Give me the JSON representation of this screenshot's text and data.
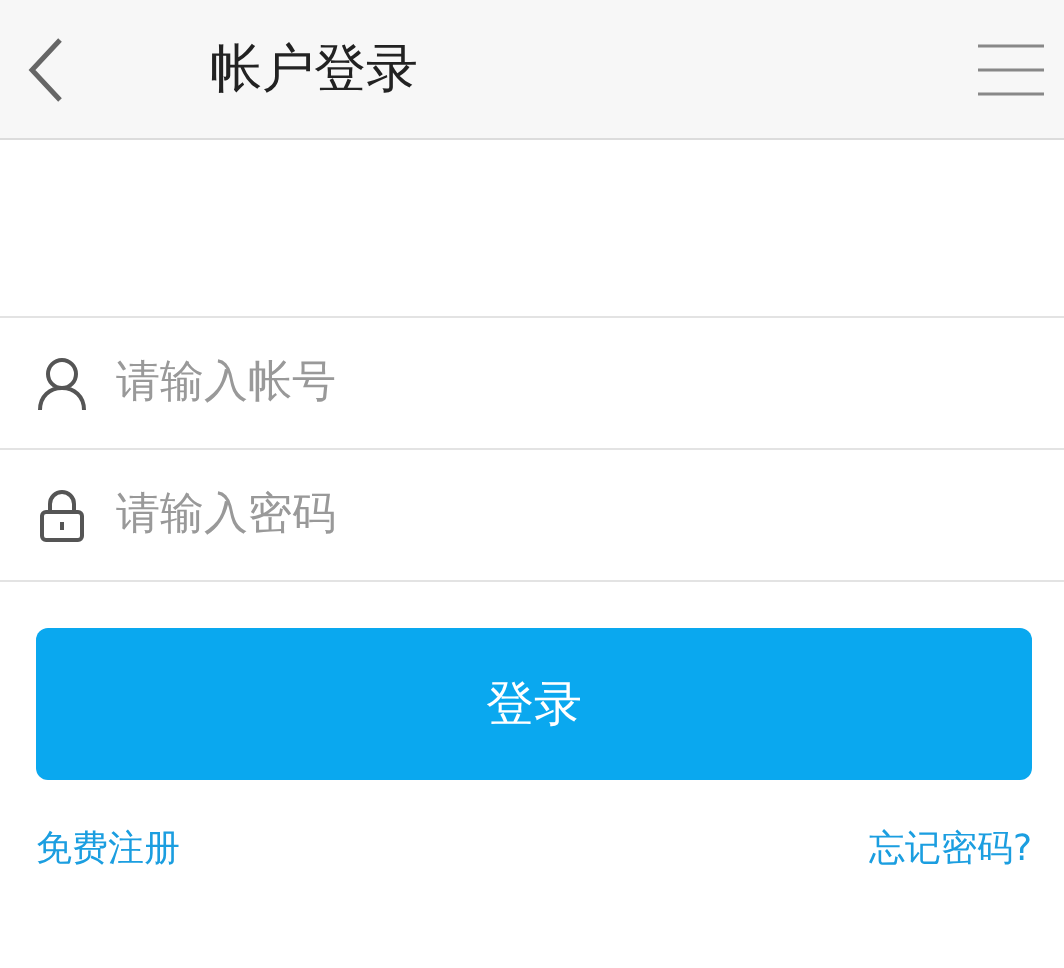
{
  "header": {
    "title": "帐户登录"
  },
  "fields": [
    {
      "kind": "user",
      "placeholder": "请输入帐号"
    },
    {
      "kind": "lock",
      "placeholder": "请输入密码"
    }
  ],
  "login_button": "登录",
  "links": {
    "register": "免费注册",
    "forgot": "忘记密码?"
  }
}
